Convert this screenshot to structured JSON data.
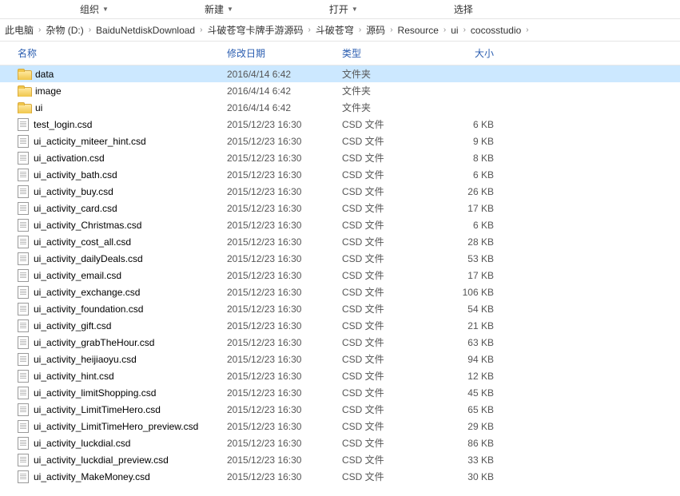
{
  "toolbar": {
    "organize": "组织",
    "new": "新建",
    "open": "打开",
    "select": "选择"
  },
  "breadcrumb": [
    "此电脑",
    "杂物 (D:)",
    "BaiduNetdiskDownload",
    "斗破苍穹卡牌手游源码",
    "斗破苍穹",
    "源码",
    "Resource",
    "ui",
    "cocosstudio"
  ],
  "columns": {
    "name": "名称",
    "date": "修改日期",
    "type": "类型",
    "size": "大小"
  },
  "folder_type": "文件夹",
  "csd_type": "CSD 文件",
  "files": [
    {
      "name": "data",
      "date": "2016/4/14 6:42",
      "type": "folder",
      "size": "",
      "selected": true
    },
    {
      "name": "image",
      "date": "2016/4/14 6:42",
      "type": "folder",
      "size": ""
    },
    {
      "name": "ui",
      "date": "2016/4/14 6:42",
      "type": "folder",
      "size": ""
    },
    {
      "name": "test_login.csd",
      "date": "2015/12/23 16:30",
      "type": "csd",
      "size": "6 KB"
    },
    {
      "name": "ui_acticity_miteer_hint.csd",
      "date": "2015/12/23 16:30",
      "type": "csd",
      "size": "9 KB"
    },
    {
      "name": "ui_activation.csd",
      "date": "2015/12/23 16:30",
      "type": "csd",
      "size": "8 KB"
    },
    {
      "name": "ui_activity_bath.csd",
      "date": "2015/12/23 16:30",
      "type": "csd",
      "size": "6 KB"
    },
    {
      "name": "ui_activity_buy.csd",
      "date": "2015/12/23 16:30",
      "type": "csd",
      "size": "26 KB"
    },
    {
      "name": "ui_activity_card.csd",
      "date": "2015/12/23 16:30",
      "type": "csd",
      "size": "17 KB"
    },
    {
      "name": "ui_activity_Christmas.csd",
      "date": "2015/12/23 16:30",
      "type": "csd",
      "size": "6 KB"
    },
    {
      "name": "ui_activity_cost_all.csd",
      "date": "2015/12/23 16:30",
      "type": "csd",
      "size": "28 KB"
    },
    {
      "name": "ui_activity_dailyDeals.csd",
      "date": "2015/12/23 16:30",
      "type": "csd",
      "size": "53 KB"
    },
    {
      "name": "ui_activity_email.csd",
      "date": "2015/12/23 16:30",
      "type": "csd",
      "size": "17 KB"
    },
    {
      "name": "ui_activity_exchange.csd",
      "date": "2015/12/23 16:30",
      "type": "csd",
      "size": "106 KB"
    },
    {
      "name": "ui_activity_foundation.csd",
      "date": "2015/12/23 16:30",
      "type": "csd",
      "size": "54 KB"
    },
    {
      "name": "ui_activity_gift.csd",
      "date": "2015/12/23 16:30",
      "type": "csd",
      "size": "21 KB"
    },
    {
      "name": "ui_activity_grabTheHour.csd",
      "date": "2015/12/23 16:30",
      "type": "csd",
      "size": "63 KB"
    },
    {
      "name": "ui_activity_heijiaoyu.csd",
      "date": "2015/12/23 16:30",
      "type": "csd",
      "size": "94 KB"
    },
    {
      "name": "ui_activity_hint.csd",
      "date": "2015/12/23 16:30",
      "type": "csd",
      "size": "12 KB"
    },
    {
      "name": "ui_activity_limitShopping.csd",
      "date": "2015/12/23 16:30",
      "type": "csd",
      "size": "45 KB"
    },
    {
      "name": "ui_activity_LimitTimeHero.csd",
      "date": "2015/12/23 16:30",
      "type": "csd",
      "size": "65 KB"
    },
    {
      "name": "ui_activity_LimitTimeHero_preview.csd",
      "date": "2015/12/23 16:30",
      "type": "csd",
      "size": "29 KB"
    },
    {
      "name": "ui_activity_luckdial.csd",
      "date": "2015/12/23 16:30",
      "type": "csd",
      "size": "86 KB"
    },
    {
      "name": "ui_activity_luckdial_preview.csd",
      "date": "2015/12/23 16:30",
      "type": "csd",
      "size": "33 KB"
    },
    {
      "name": "ui_activity_MakeMoney.csd",
      "date": "2015/12/23 16:30",
      "type": "csd",
      "size": "30 KB"
    }
  ]
}
